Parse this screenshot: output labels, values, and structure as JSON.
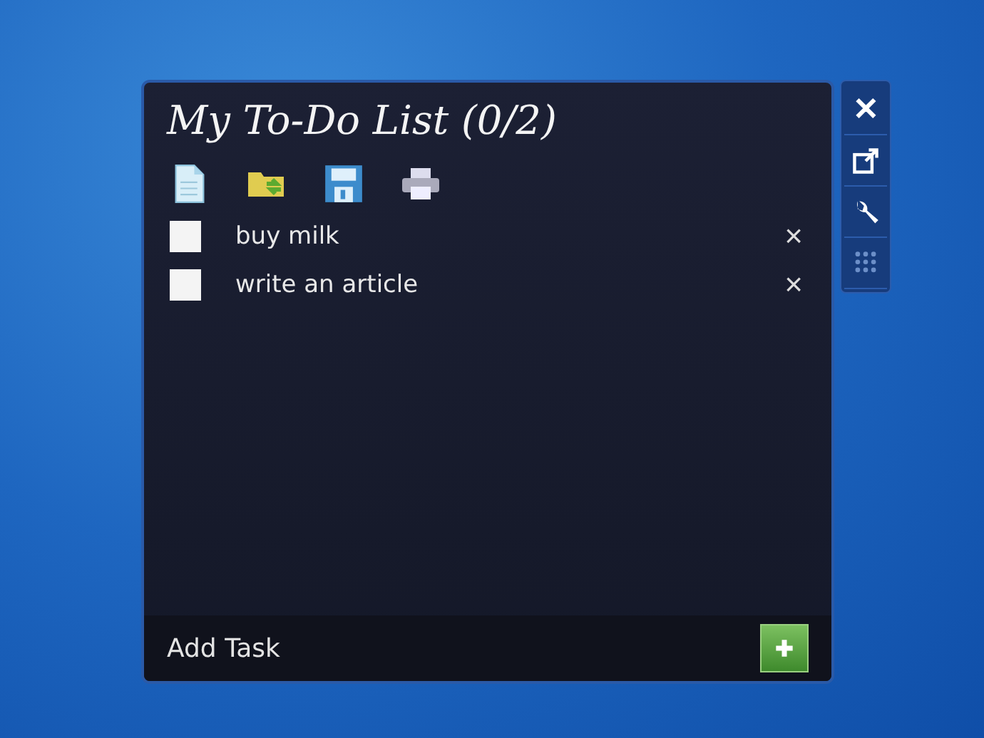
{
  "gadget": {
    "title": "My To-Do List (0/2)",
    "tasks": [
      {
        "text": "buy milk",
        "checked": false,
        "remove": "×"
      },
      {
        "text": "write an article",
        "checked": false,
        "remove": "×"
      }
    ],
    "add_task": {
      "placeholder": "Add Task"
    }
  },
  "side_controls": {
    "close": "✕"
  }
}
